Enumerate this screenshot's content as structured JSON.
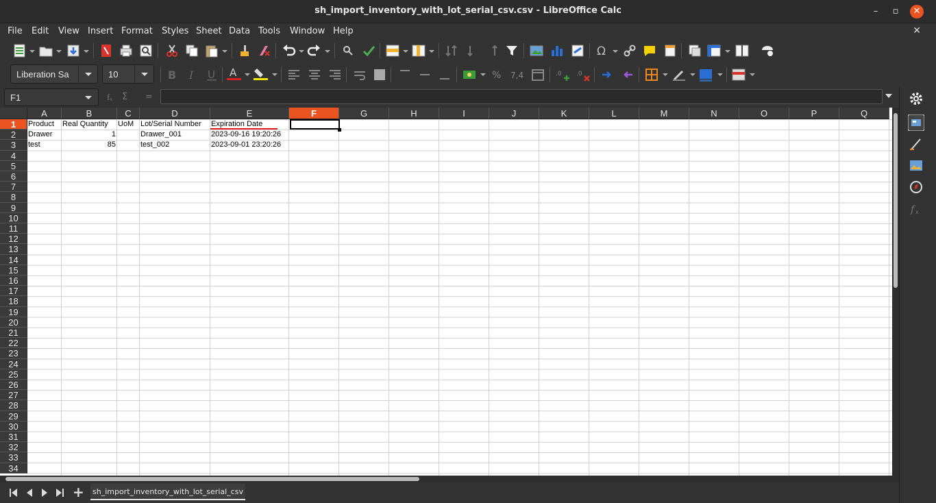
{
  "window": {
    "title": "sh_import_inventory_with_lot_serial_csv.csv - LibreOffice Calc",
    "minimize": "–",
    "restore": "▫",
    "close": "✕"
  },
  "menubar": {
    "items": [
      "File",
      "Edit",
      "View",
      "Insert",
      "Format",
      "Styles",
      "Sheet",
      "Data",
      "Tools",
      "Window",
      "Help"
    ],
    "doc_close": "✕"
  },
  "toolbar": {
    "font_name": "Liberation Sa",
    "font_size": "10",
    "colors": {
      "font_color_underline": "#e02020",
      "highlight_underline": "#f3e600",
      "accent": "#e95420"
    }
  },
  "formulabar": {
    "name_box": "F1",
    "function_wizard": "fₓ",
    "sum_icon": "Σ",
    "equals": "=",
    "formula": ""
  },
  "grid": {
    "columns": [
      "A",
      "B",
      "C",
      "D",
      "E",
      "F",
      "G",
      "H",
      "I",
      "J",
      "K",
      "L",
      "M",
      "N",
      "O",
      "P",
      "Q"
    ],
    "active_column": "F",
    "active_row": "1",
    "rows": [
      "1",
      "2",
      "3",
      "4",
      "5",
      "6",
      "7",
      "8",
      "9",
      "10",
      "11",
      "12",
      "13",
      "14",
      "15",
      "16",
      "17",
      "18",
      "19",
      "20",
      "21",
      "22",
      "23",
      "24",
      "25",
      "26",
      "27",
      "28",
      "29",
      "30",
      "31",
      "32",
      "33",
      "34"
    ],
    "data": [
      [
        "Product",
        "Real Quantity",
        "UoM",
        "Lot/Serial Number",
        "Expiration Date"
      ],
      [
        "Drawer",
        "1",
        "",
        "Drawer_001",
        "2023-09-16 19:20:26"
      ],
      [
        "test",
        "85",
        "",
        "test_002",
        "2023-09-01 23:20:26"
      ]
    ]
  },
  "sheets": {
    "tabs": [
      "sh_import_inventory_with_lot_serial_csv"
    ],
    "add_label": "+"
  }
}
